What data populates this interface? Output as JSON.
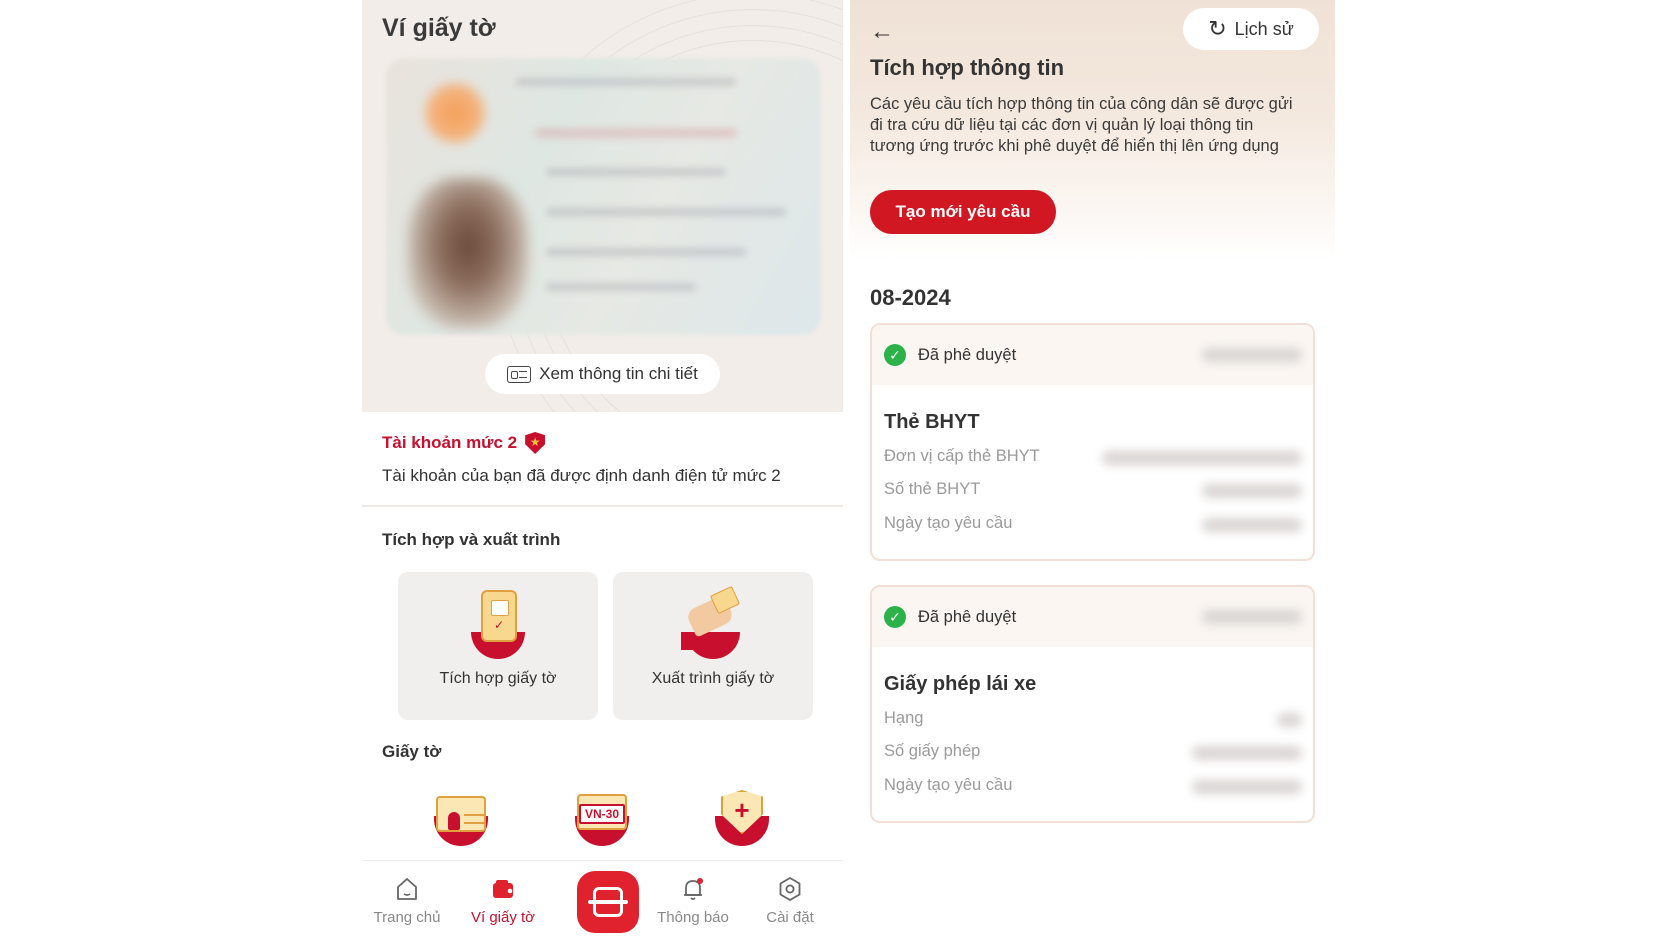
{
  "left": {
    "title": "Ví giấy tờ",
    "detail_button": "Xem thông tin chi tiết",
    "account_level": "Tài khoản mức 2",
    "account_desc": "Tài khoản của bạn đã được định danh điện tử mức 2",
    "integrate_section": "Tích hợp và xuất trình",
    "tiles": [
      {
        "label": "Tích hợp giấy tờ",
        "icon": "phone-document-icon"
      },
      {
        "label": "Xuất trình giấy tờ",
        "icon": "hand-document-icon"
      }
    ],
    "documents_section": "Giấy tờ",
    "documents": [
      {
        "icon": "id-card-icon"
      },
      {
        "icon": "license-plate-icon",
        "text": "VN-30"
      },
      {
        "icon": "health-insurance-icon"
      }
    ],
    "nav": [
      {
        "label": "Trang chủ",
        "icon": "home-icon",
        "active": false
      },
      {
        "label": "Ví giấy tờ",
        "icon": "wallet-icon",
        "active": true
      },
      {
        "label": "Thông báo",
        "icon": "bell-icon",
        "active": false
      },
      {
        "label": "Cài đặt",
        "icon": "settings-icon",
        "active": false
      }
    ],
    "scan_icon": "scan-icon"
  },
  "right": {
    "history_button": "Lịch sử",
    "title": "Tích hợp thông tin",
    "description": "Các yêu cầu tích hợp thông tin của công dân sẽ được gửi đi tra cứu dữ liệu tại các đơn vị quản lý loại thông tin tương ứng trước khi phê duyệt để hiển thị lên ứng dụng",
    "create_button": "Tạo mới yêu cầu",
    "month": "08-2024",
    "requests": [
      {
        "status": "Đã phê duyệt",
        "title": "Thẻ BHYT",
        "fields": [
          "Đơn vị cấp thẻ BHYT",
          "Số thẻ BHYT",
          "Ngày tạo yêu cầu"
        ]
      },
      {
        "status": "Đã phê duyệt",
        "title": "Giấy phép lái xe",
        "fields": [
          "Hạng",
          "Số giấy phép",
          "Ngày tạo yêu cầu"
        ]
      }
    ]
  },
  "colors": {
    "brand_red": "#c8102e",
    "approved_green": "#2bb34a"
  }
}
